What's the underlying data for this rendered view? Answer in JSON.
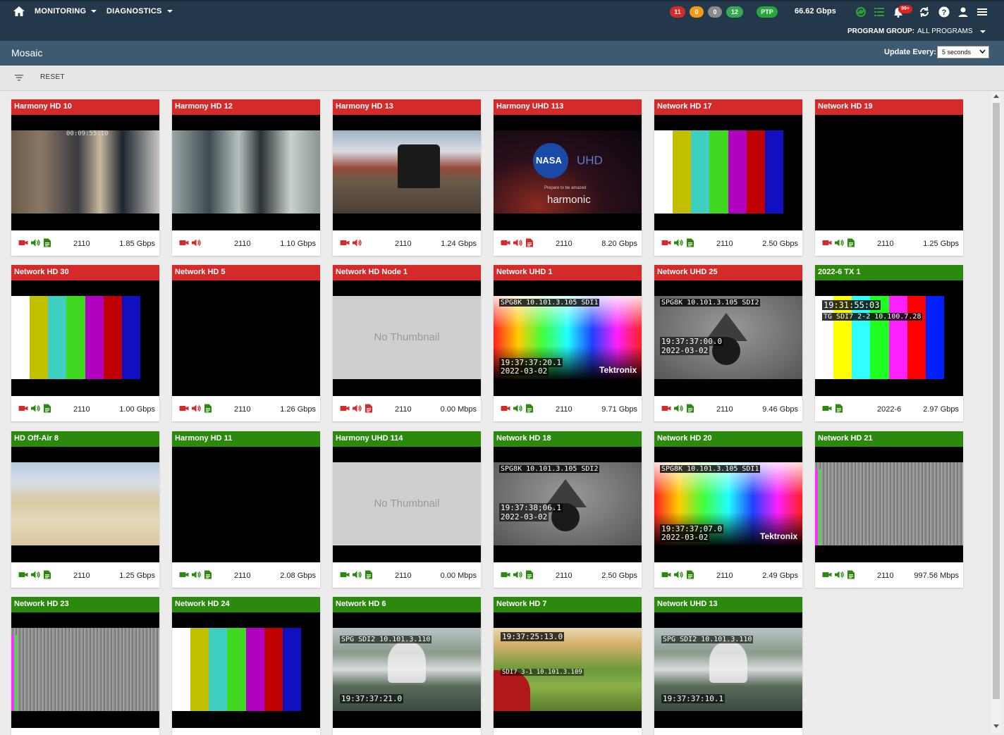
{
  "nav": {
    "monitoring": "MONITORING",
    "diagnostics": "DIAGNOSTICS",
    "status_counts": [
      {
        "value": "11",
        "color": "#d42a2a"
      },
      {
        "value": "0",
        "color": "#f29b17"
      },
      {
        "value": "0",
        "color": "#8a8a8a"
      },
      {
        "value": "12",
        "color": "#34a853"
      }
    ],
    "ptp": "PTP",
    "bandwidth": "66.62 Gbps",
    "notifications": "99+",
    "program_group_label": "PROGRAM GROUP:",
    "program_group_value": "ALL PROGRAMS"
  },
  "page": {
    "title": "Mosaic",
    "update_label": "Update Every:",
    "update_value": "5 seconds"
  },
  "filter": {
    "reset": "RESET"
  },
  "tiles": [
    {
      "name": "Harmony HD 10",
      "status": "red",
      "std": "2110",
      "rate": "1.85 Gbps",
      "icons": [
        "red",
        "green",
        "green"
      ],
      "thumb": "scene1",
      "osd": [
        "00:09:55:10"
      ]
    },
    {
      "name": "Harmony HD 12",
      "status": "red",
      "std": "2110",
      "rate": "1.10 Gbps",
      "icons": [
        "red",
        "red"
      ],
      "thumb": "scene2",
      "osd": []
    },
    {
      "name": "Harmony HD 13",
      "status": "red",
      "std": "2110",
      "rate": "1.24 Gbps",
      "icons": [
        "red",
        "red"
      ],
      "thumb": "train",
      "osd": []
    },
    {
      "name": "Harmony UHD 113",
      "status": "red",
      "std": "2110",
      "rate": "8.20 Gbps",
      "icons": [
        "red",
        "red",
        "red"
      ],
      "thumb": "nasa",
      "osd": [
        "NASA",
        "UHD",
        "Prepare to be amazed",
        "harmonic"
      ]
    },
    {
      "name": "Network HD 17",
      "status": "red",
      "std": "2110",
      "rate": "2.50 Gbps",
      "icons": [
        "red",
        "green",
        "green"
      ],
      "thumb": "bars",
      "osd": []
    },
    {
      "name": "Network HD 19",
      "status": "red",
      "std": "2110",
      "rate": "1.25 Gbps",
      "icons": [
        "red",
        "green",
        "green"
      ],
      "thumb": "black",
      "osd": []
    },
    {
      "name": "Network HD 30",
      "status": "red",
      "std": "2110",
      "rate": "1.00 Gbps",
      "icons": [
        "red",
        "green",
        "green"
      ],
      "thumb": "bars",
      "osd": []
    },
    {
      "name": "Network HD 5",
      "status": "red",
      "std": "2110",
      "rate": "1.26 Gbps",
      "icons": [
        "red",
        "red",
        "green"
      ],
      "thumb": "empty",
      "osd": []
    },
    {
      "name": "Network HD Node 1",
      "status": "red",
      "std": "2110",
      "rate": "0.00 Mbps",
      "icons": [
        "red",
        "red",
        "red"
      ],
      "thumb": "nothumb",
      "osd": [
        "No Thumbnail"
      ]
    },
    {
      "name": "Network UHD 1",
      "status": "red",
      "std": "2110",
      "rate": "9.71 Gbps",
      "icons": [
        "red",
        "green",
        "green"
      ],
      "thumb": "spectrum",
      "osd": [
        "SPG8K 10.101.3.105 SDI1",
        "19:37:37:20.1",
        "2022-03-02",
        "Tektronix"
      ]
    },
    {
      "name": "Network UHD 25",
      "status": "red",
      "std": "2110",
      "rate": "9.46 Gbps",
      "icons": [
        "red",
        "green",
        "green"
      ],
      "thumb": "grey",
      "osd": [
        "SPG8K 10.101.3.105 SDI2",
        "19:37:37:00.0",
        "2022-03-02"
      ]
    },
    {
      "name": "2022-6 TX 1",
      "status": "green",
      "std": "2022-6",
      "rate": "2.97 Gbps",
      "icons": [
        "green",
        "green"
      ],
      "thumb": "bars2",
      "osd": [
        "19:31:55:03",
        "TG SDI7 2-2 10.100.7.28"
      ]
    },
    {
      "name": "HD Off-Air 8",
      "status": "green",
      "std": "2110",
      "rate": "1.25 Gbps",
      "icons": [
        "green",
        "green",
        "green"
      ],
      "thumb": "dunes",
      "osd": []
    },
    {
      "name": "Harmony HD 11",
      "status": "green",
      "std": "2110",
      "rate": "2.08 Gbps",
      "icons": [
        "green",
        "green",
        "green"
      ],
      "thumb": "empty",
      "osd": []
    },
    {
      "name": "Harmony UHD 114",
      "status": "green",
      "std": "2110",
      "rate": "0.00 Mbps",
      "icons": [
        "green",
        "green",
        "green"
      ],
      "thumb": "nothumb",
      "osd": [
        "No Thumbnail"
      ]
    },
    {
      "name": "Network HD 18",
      "status": "green",
      "std": "2110",
      "rate": "2.50 Gbps",
      "icons": [
        "green",
        "green",
        "green"
      ],
      "thumb": "grey",
      "osd": [
        "SPG8K 10.101.3.105 SDI2",
        "19:37:38;06.1",
        "2022-03-02"
      ]
    },
    {
      "name": "Network HD 20",
      "status": "green",
      "std": "2110",
      "rate": "2.49 Gbps",
      "icons": [
        "green",
        "green",
        "green"
      ],
      "thumb": "spectrum",
      "osd": [
        "SPG8K 10.101.3.105 SDI1",
        "19:37:37;07.0",
        "2022-03-02",
        "Tektronix"
      ]
    },
    {
      "name": "Network HD 21",
      "status": "green",
      "std": "2110",
      "rate": "997.56 Mbps",
      "icons": [
        "green",
        "green",
        "green"
      ],
      "thumb": "stripes",
      "osd": []
    },
    {
      "name": "Network HD 23",
      "status": "green",
      "std": "",
      "rate": "",
      "icons": [],
      "thumb": "stripes",
      "osd": []
    },
    {
      "name": "Network HD 24",
      "status": "green",
      "std": "",
      "rate": "",
      "icons": [],
      "thumb": "bars",
      "osd": []
    },
    {
      "name": "Network HD 6",
      "status": "green",
      "std": "",
      "rate": "",
      "icons": [],
      "thumb": "fountain",
      "osd": [
        "SPG SDI2 10.101.3.110",
        "19:37:37:21.0"
      ]
    },
    {
      "name": "Network HD 7",
      "status": "green",
      "std": "",
      "rate": "",
      "icons": [],
      "thumb": "bike",
      "osd": [
        "19:37:25:13.0",
        "SDI7 3-1 10.101.3.109"
      ]
    },
    {
      "name": "Network UHD 13",
      "status": "green",
      "std": "",
      "rate": "",
      "icons": [],
      "thumb": "fountain",
      "osd": [
        "SPG SDI2 10.101.3.110",
        "19:37:37:10.1"
      ]
    }
  ]
}
